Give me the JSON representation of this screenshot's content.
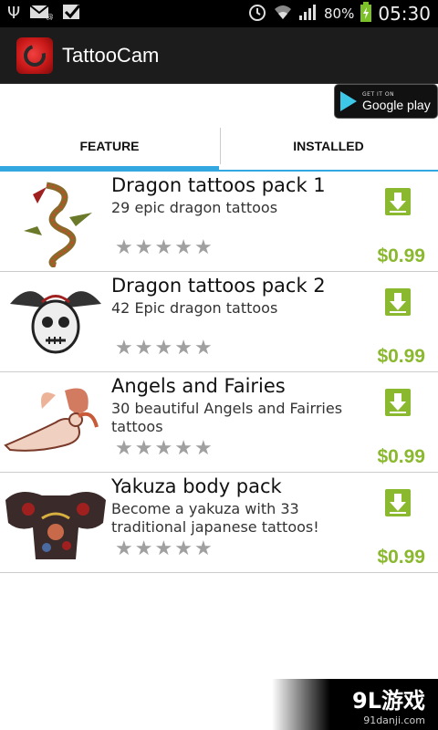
{
  "status_bar": {
    "left_icons": [
      "usb-icon",
      "mail-icon",
      "check-icon"
    ],
    "battery_percent": "80%",
    "time": "05:30"
  },
  "action_bar": {
    "app_title": "TattooCam"
  },
  "play_badge": {
    "small_text": "GET IT ON",
    "big_text": "Google play"
  },
  "tabs": [
    {
      "label": "FEATURE",
      "active": true
    },
    {
      "label": "INSTALLED",
      "active": false
    }
  ],
  "items": [
    {
      "title": "Dragon tattoos pack 1",
      "description": "29 epic dragon tattoos",
      "price": "$0.99",
      "rating": 0
    },
    {
      "title": "Dragon tattoos pack 2",
      "description": "42 Epic dragon tattoos",
      "price": "$0.99",
      "rating": 0
    },
    {
      "title": "Angels and Fairies",
      "description": "30 beautiful Angels and Fairries tattoos",
      "price": "$0.99",
      "rating": 0
    },
    {
      "title": "Yakuza body pack",
      "description": "Become a yakuza with 33 traditional japanese tattoos!",
      "price": "$0.99",
      "rating": 0
    }
  ],
  "watermark": {
    "logo": "9L游戏",
    "url": "91danji.com"
  },
  "colors": {
    "accent": "#33a8e0",
    "price": "#8ab82e",
    "download": "#8ab82e"
  }
}
